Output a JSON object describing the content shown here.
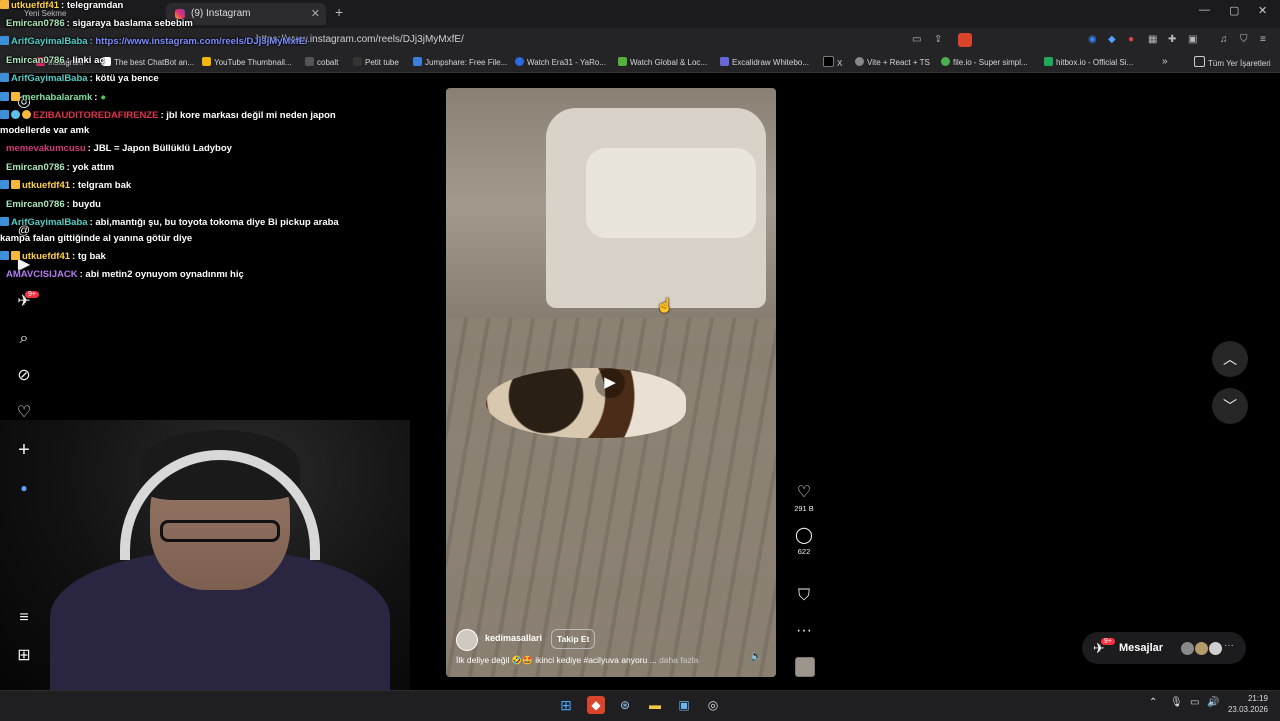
{
  "browser": {
    "prev_tab": "Yeni Sekme",
    "tab_title": "(9) Instagram",
    "tab_close": "✕",
    "new_tab": "+",
    "url": "https://www.instagram.com/reels/DJj3jMyMxfE/",
    "window_min": "—",
    "window_max": "▢",
    "window_close": "✕",
    "bookmarks": [
      {
        "label": "Instagram",
        "color": "#e1306c"
      },
      {
        "label": "The best ChatBot an...",
        "color": "#ffffff"
      },
      {
        "label": "YouTube Thumbnail...",
        "color": "#f2b705"
      },
      {
        "label": "cobalt",
        "color": "#333333"
      },
      {
        "label": "Petit tube",
        "color": "#111111"
      },
      {
        "label": "Jumpshare: Free File...",
        "color": "#3b7ddd"
      },
      {
        "label": "Watch Era31 - YaRo...",
        "color": "#2a6be0"
      },
      {
        "label": "Watch Global & Loc...",
        "color": "#53b03a"
      },
      {
        "label": "Excalidraw Whitebo...",
        "color": "#6965db"
      },
      {
        "label": "X",
        "color": "#000000"
      },
      {
        "label": "Vite + React + TS",
        "color": "#888888"
      },
      {
        "label": "file.io - Super simpl...",
        "color": "#4caf50"
      },
      {
        "label": "hitbox.io - Official Si...",
        "color": "#1faa59"
      }
    ],
    "bookmarks_more": "»",
    "all_bookmarks": "Tüm Yer İşaretleri"
  },
  "chat": [
    {
      "user": "utkuefdf41",
      "text": ": telegramdan",
      "color": "#ffd24a"
    },
    {
      "user": "Emircan0786",
      "text": ": sigaraya baslama sebebim",
      "color": "#a9e6b9"
    },
    {
      "user": "ArifGayimalBaba",
      "text": ": https://www.instagram.com/reels/DJj3jMyMxfE/",
      "color": "#4fd0c8"
    },
    {
      "user": "Emircan0786",
      "text": ": linki aç",
      "color": "#a9e6b9"
    },
    {
      "user": "ArifGayimalBaba",
      "text": ": kötü ya bence",
      "color": "#4fd0c8"
    },
    {
      "user": "merhabalaramk",
      "text": ":",
      "color": "#7ee0a0"
    },
    {
      "user": "EZIBAUDITOREDAFIRENZE",
      "text": ": jbl kore markası değil mi neden japon",
      "color": "#e0334a"
    },
    {
      "user": "",
      "text": "modellerde var amk",
      "color": "#ffffff"
    },
    {
      "user": "memevakumcusu",
      "text": ": JBL = Japon Büllüklü Ladyboy",
      "color": "#d23a7a"
    },
    {
      "user": "Emircan0786",
      "text": ": yok attım",
      "color": "#a9e6b9"
    },
    {
      "user": "utkuefdf41",
      "text": ": telgram bak",
      "color": "#ffd24a"
    },
    {
      "user": "Emircan0786",
      "text": ": buydu",
      "color": "#a9e6b9"
    },
    {
      "user": "ArifGayimalBaba",
      "text": ": abi,mantığı şu, bu toyota tokoma diye Bi pickup araba",
      "color": "#4fd0c8"
    },
    {
      "user": "",
      "text": "kampa falan gittiğinde al yanına götür diye",
      "color": "#ffffff"
    },
    {
      "user": "utkuefdf41",
      "text": ": tg bak",
      "color": "#ffd24a"
    },
    {
      "user": "AMAVCISIJACK",
      "text": ": abi metin2 oynuyom oynadınmı hiç",
      "color": "#b57cf2"
    }
  ],
  "sidebar": {
    "notifications_badge": "9+"
  },
  "reel": {
    "author": "kedimasallari",
    "follow_label": "Takip Et",
    "caption": "İlk deliye değil 🤣🤩 ikinci kediye #acilyuva anyoru ...",
    "caption_more": "daha fazla",
    "likes": "291 B",
    "comments": "622"
  },
  "messages": {
    "label": "Mesajlar",
    "badge": "9+"
  },
  "taskbar": {
    "time": "21:19",
    "date": "23.03.2026"
  }
}
